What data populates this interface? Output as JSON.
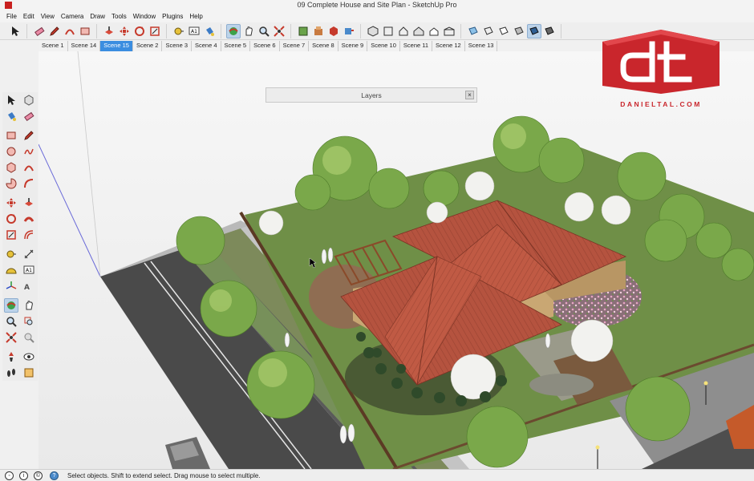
{
  "window": {
    "title": "09 Complete House and Site Plan - SketchUp Pro"
  },
  "menu": [
    "File",
    "Edit",
    "View",
    "Camera",
    "Draw",
    "Tools",
    "Window",
    "Plugins",
    "Help"
  ],
  "scenes": {
    "tabs": [
      "Scene 1",
      "Scene 14",
      "Scene 15",
      "Scene 2",
      "Scene 3",
      "Scene 4",
      "Scene 5",
      "Scene 6",
      "Scene 7",
      "Scene 8",
      "Scene 9",
      "Scene 10",
      "Scene 11",
      "Scene 12",
      "Scene 13"
    ],
    "active": "Scene 15"
  },
  "layers_panel": {
    "title": "Layers",
    "close_label": "×"
  },
  "logo": {
    "mark": "dt",
    "text": "DANIELTAL.COM",
    "color": "#c9262c"
  },
  "status": {
    "text": "Select objects. Shift to extend select. Drag mouse to select multiple.",
    "icons": [
      "geo-location-icon",
      "info-icon",
      "credits-icon"
    ]
  },
  "toolbar_icons": [
    "select-icon",
    "eraser-icon",
    "pencil-icon",
    "arc-icon",
    "rectangle-icon",
    "pushpull-icon",
    "move-icon",
    "rotate-icon",
    "scale-icon",
    "offset-icon",
    "tape-measure-icon",
    "text-icon",
    "paint-bucket-icon",
    "orbit-icon",
    "pan-icon",
    "zoom-icon",
    "zoom-extents-icon",
    "components-icon",
    "warehouse-icon",
    "extension-icon",
    "iso-view-icon",
    "top-view-icon",
    "front-view-icon",
    "right-view-icon",
    "back-view-icon",
    "left-view-icon",
    "xray-icon",
    "wireframe-icon",
    "hidden-line-icon",
    "shaded-icon",
    "textured-icon",
    "monochrome-icon"
  ],
  "colors": {
    "accent": "#3b8de0",
    "roof": "#b5533f",
    "grass": "#6f8f47",
    "road": "#4a4a4a"
  }
}
